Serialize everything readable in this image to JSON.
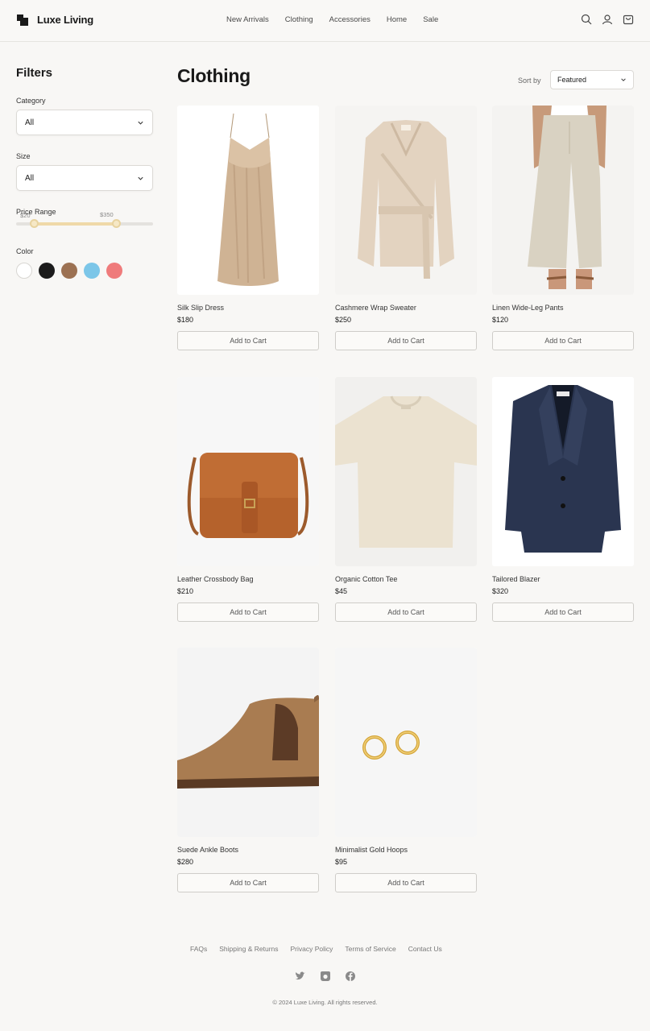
{
  "header": {
    "brand": "Luxe Living",
    "nav": [
      "New Arrivals",
      "Clothing",
      "Accessories",
      "Home",
      "Sale"
    ],
    "icons": [
      "search-icon",
      "user-icon",
      "cart-icon"
    ]
  },
  "filters": {
    "title": "Filters",
    "category": {
      "label": "Category",
      "value": "All"
    },
    "size": {
      "label": "Size",
      "value": "All"
    },
    "price": {
      "label": "Price Range",
      "min_label": "$20",
      "max_label": "$350",
      "min_fraction": 0.13,
      "max_fraction": 0.73
    },
    "color": {
      "label": "Color",
      "swatches": [
        "#ffffff",
        "#1c1c1c",
        "#9c7152",
        "#7cc6e8",
        "#ef7b7b"
      ]
    }
  },
  "main": {
    "title": "Clothing",
    "sort_label": "Sort by",
    "sort_value": "Featured",
    "add_to_cart": "Add to Cart"
  },
  "products": [
    {
      "name": "Silk Slip Dress",
      "price": "$180"
    },
    {
      "name": "Cashmere Wrap Sweater",
      "price": "$250"
    },
    {
      "name": "Linen Wide-Leg Pants",
      "price": "$120"
    },
    {
      "name": "Leather Crossbody Bag",
      "price": "$210"
    },
    {
      "name": "Organic Cotton Tee",
      "price": "$45"
    },
    {
      "name": "Tailored Blazer",
      "price": "$320"
    },
    {
      "name": "Suede Ankle Boots",
      "price": "$280"
    },
    {
      "name": "Minimalist Gold Hoops",
      "price": "$95"
    }
  ],
  "footer": {
    "links": [
      "FAQs",
      "Shipping & Returns",
      "Privacy Policy",
      "Terms of Service",
      "Contact Us"
    ],
    "social": [
      "twitter-icon",
      "instagram-icon",
      "facebook-icon"
    ],
    "copyright": "© 2024 Luxe Living. All rights reserved."
  },
  "colors": {
    "accent": "#efd9a8",
    "background": "#f8f7f5",
    "text": "#1a1a1a"
  }
}
